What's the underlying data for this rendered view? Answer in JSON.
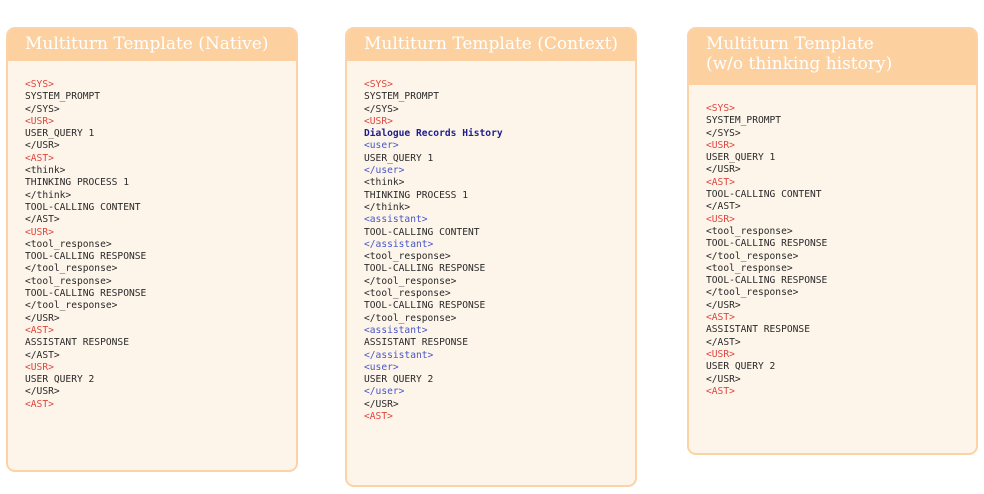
{
  "templates": [
    {
      "title_lines": [
        "Multiturn Template (Native)"
      ],
      "lines": [
        {
          "t": "<SYS>",
          "k": "tag"
        },
        {
          "t": "SYSTEM_PROMPT",
          "k": "text"
        },
        {
          "t": "</SYS>",
          "k": "text"
        },
        {
          "t": "<USR>",
          "k": "tag"
        },
        {
          "t": "USER_QUERY 1",
          "k": "text"
        },
        {
          "t": "</USR>",
          "k": "text"
        },
        {
          "t": "<AST>",
          "k": "tag"
        },
        {
          "t": "<think>",
          "k": "text"
        },
        {
          "t": "THINKING PROCESS 1",
          "k": "text"
        },
        {
          "t": "</think>",
          "k": "text"
        },
        {
          "t": "TOOL-CALLING CONTENT",
          "k": "text"
        },
        {
          "t": "</AST>",
          "k": "text"
        },
        {
          "t": "<USR>",
          "k": "tag"
        },
        {
          "t": "<tool_response>",
          "k": "text"
        },
        {
          "t": "TOOL-CALLING RESPONSE",
          "k": "text"
        },
        {
          "t": "</tool_response>",
          "k": "text"
        },
        {
          "t": "<tool_response>",
          "k": "text"
        },
        {
          "t": "TOOL-CALLING RESPONSE",
          "k": "text"
        },
        {
          "t": "</tool_response>",
          "k": "text"
        },
        {
          "t": "</USR>",
          "k": "text"
        },
        {
          "t": "<AST>",
          "k": "tag"
        },
        {
          "t": "ASSISTANT RESPONSE",
          "k": "text"
        },
        {
          "t": "</AST>",
          "k": "text"
        },
        {
          "t": "<USR>",
          "k": "tag"
        },
        {
          "t": "USER QUERY 2",
          "k": "text"
        },
        {
          "t": "</USR>",
          "k": "text"
        },
        {
          "t": "<AST>",
          "k": "tag"
        }
      ]
    },
    {
      "title_lines": [
        "Multiturn Template (Context)"
      ],
      "lines": [
        {
          "t": "<SYS>",
          "k": "tag"
        },
        {
          "t": "SYSTEM_PROMPT",
          "k": "text"
        },
        {
          "t": "</SYS>",
          "k": "text"
        },
        {
          "t": "<USR>",
          "k": "tag"
        },
        {
          "t": "Dialogue Records History",
          "k": "hl"
        },
        {
          "t": "<user>",
          "k": "sub"
        },
        {
          "t": "USER_QUERY 1",
          "k": "text"
        },
        {
          "t": "</user>",
          "k": "sub"
        },
        {
          "t": "<think>",
          "k": "text"
        },
        {
          "t": "THINKING PROCESS 1",
          "k": "text"
        },
        {
          "t": "</think>",
          "k": "text"
        },
        {
          "t": "<assistant>",
          "k": "sub"
        },
        {
          "t": "TOOL-CALLING CONTENT",
          "k": "text"
        },
        {
          "t": "</assistant>",
          "k": "sub"
        },
        {
          "t": "<tool_response>",
          "k": "text"
        },
        {
          "t": "TOOL-CALLING RESPONSE",
          "k": "text"
        },
        {
          "t": "</tool_response>",
          "k": "text"
        },
        {
          "t": "<tool_response>",
          "k": "text"
        },
        {
          "t": "TOOL-CALLING RESPONSE",
          "k": "text"
        },
        {
          "t": "</tool_response>",
          "k": "text"
        },
        {
          "t": "<assistant>",
          "k": "sub"
        },
        {
          "t": "ASSISTANT RESPONSE",
          "k": "text"
        },
        {
          "t": "</assistant>",
          "k": "sub"
        },
        {
          "t": "<user>",
          "k": "sub"
        },
        {
          "t": "USER QUERY 2",
          "k": "text"
        },
        {
          "t": "</user>",
          "k": "sub"
        },
        {
          "t": "</USR>",
          "k": "text"
        },
        {
          "t": "<AST>",
          "k": "tag"
        }
      ]
    },
    {
      "title_lines": [
        "Multiturn Template",
        "(w/o thinking history)"
      ],
      "lines": [
        {
          "t": "<SYS>",
          "k": "tag"
        },
        {
          "t": "SYSTEM_PROMPT",
          "k": "text"
        },
        {
          "t": "</SYS>",
          "k": "text"
        },
        {
          "t": "<USR>",
          "k": "tag"
        },
        {
          "t": "USER_QUERY 1",
          "k": "text"
        },
        {
          "t": "</USR>",
          "k": "text"
        },
        {
          "t": "<AST>",
          "k": "tag"
        },
        {
          "t": "TOOL-CALLING CONTENT",
          "k": "text"
        },
        {
          "t": "</AST>",
          "k": "text"
        },
        {
          "t": "<USR>",
          "k": "tag"
        },
        {
          "t": "<tool_response>",
          "k": "text"
        },
        {
          "t": "TOOL-CALLING RESPONSE",
          "k": "text"
        },
        {
          "t": "</tool_response>",
          "k": "text"
        },
        {
          "t": "<tool_response>",
          "k": "text"
        },
        {
          "t": "TOOL-CALLING RESPONSE",
          "k": "text"
        },
        {
          "t": "</tool_response>",
          "k": "text"
        },
        {
          "t": "</USR>",
          "k": "text"
        },
        {
          "t": "<AST>",
          "k": "tag"
        },
        {
          "t": "ASSISTANT RESPONSE",
          "k": "text"
        },
        {
          "t": "</AST>",
          "k": "text"
        },
        {
          "t": "<USR>",
          "k": "tag"
        },
        {
          "t": "USER QUERY 2",
          "k": "text"
        },
        {
          "t": "</USR>",
          "k": "text"
        },
        {
          "t": "<AST>",
          "k": "tag"
        }
      ]
    }
  ]
}
